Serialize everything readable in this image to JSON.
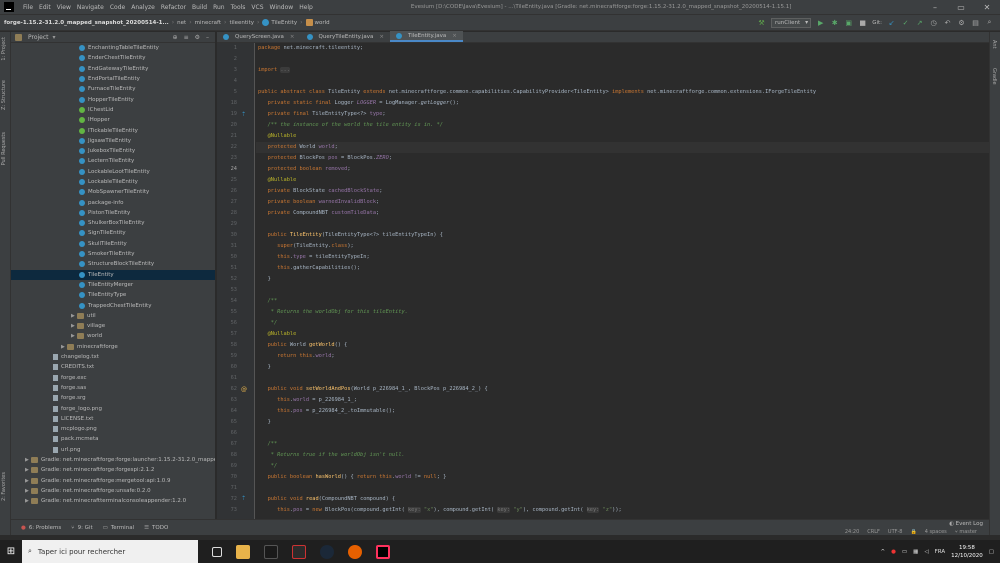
{
  "menubar": {
    "items": [
      "File",
      "Edit",
      "View",
      "Navigate",
      "Code",
      "Analyze",
      "Refactor",
      "Build",
      "Run",
      "Tools",
      "VCS",
      "Window",
      "Help"
    ],
    "title": "Evesium [D:\\CODE\\Java\\Evesium] - ...\\TileEntity.java [Gradle: net.minecraftforge:forge:1.15.2-31.2.0_mapped_snapshot_20200514-1.15.1]"
  },
  "navbar": {
    "project": "forge-1.15.2-31.2.0_mapped_snapshot_20200514-1...",
    "crumbs": [
      "net",
      "minecraft",
      "tileentity",
      "TileEntity",
      "world"
    ],
    "run_config": "runClient",
    "git_label": "Git:"
  },
  "left_strip": {
    "project": "1: Project",
    "structure": "Z: Structure",
    "pull_requests": "Pull Requests",
    "favorites": "2: Favorites"
  },
  "right_strip": {
    "ant": "Ant",
    "gradle": "Gradle"
  },
  "project_panel": {
    "title": "Project",
    "tree": [
      {
        "label": "EnchantingTableTileEntity",
        "kind": "cls",
        "indent": 68
      },
      {
        "label": "EnderChestTileEntity",
        "kind": "cls",
        "indent": 68
      },
      {
        "label": "EndGatewayTileEntity",
        "kind": "cls",
        "indent": 68
      },
      {
        "label": "EndPortalTileEntity",
        "kind": "cls",
        "indent": 68
      },
      {
        "label": "FurnaceTileEntity",
        "kind": "cls",
        "indent": 68
      },
      {
        "label": "HopperTileEntity",
        "kind": "cls",
        "indent": 68
      },
      {
        "label": "IChestLid",
        "kind": "i",
        "indent": 68
      },
      {
        "label": "IHopper",
        "kind": "i",
        "indent": 68
      },
      {
        "label": "ITickableTileEntity",
        "kind": "i",
        "indent": 68
      },
      {
        "label": "JigsawTileEntity",
        "kind": "cls",
        "indent": 68
      },
      {
        "label": "JukeboxTileEntity",
        "kind": "cls",
        "indent": 68
      },
      {
        "label": "LecternTileEntity",
        "kind": "cls",
        "indent": 68
      },
      {
        "label": "LockableLootTileEntity",
        "kind": "cls",
        "indent": 68
      },
      {
        "label": "LockableTileEntity",
        "kind": "cls",
        "indent": 68
      },
      {
        "label": "MobSpawnerTileEntity",
        "kind": "cls",
        "indent": 68
      },
      {
        "label": "package-info",
        "kind": "cls",
        "indent": 68
      },
      {
        "label": "PistonTileEntity",
        "kind": "cls",
        "indent": 68
      },
      {
        "label": "ShulkerBoxTileEntity",
        "kind": "cls",
        "indent": 68
      },
      {
        "label": "SignTileEntity",
        "kind": "cls",
        "indent": 68
      },
      {
        "label": "SkullTileEntity",
        "kind": "cls",
        "indent": 68
      },
      {
        "label": "SmokerTileEntity",
        "kind": "cls",
        "indent": 68
      },
      {
        "label": "StructureBlockTileEntity",
        "kind": "cls",
        "indent": 68
      },
      {
        "label": "TileEntity",
        "kind": "cls",
        "indent": 68,
        "selected": true
      },
      {
        "label": "TileEntityMerger",
        "kind": "cls",
        "indent": 68
      },
      {
        "label": "TileEntityType",
        "kind": "cls",
        "indent": 68
      },
      {
        "label": "TrappedChestTileEntity",
        "kind": "cls",
        "indent": 68
      },
      {
        "label": "util",
        "kind": "fold",
        "indent": 60,
        "arrow": "▶"
      },
      {
        "label": "village",
        "kind": "fold",
        "indent": 60,
        "arrow": "▶"
      },
      {
        "label": "world",
        "kind": "fold",
        "indent": 60,
        "arrow": "▶"
      },
      {
        "label": "minecraftforge",
        "kind": "fold",
        "indent": 50,
        "arrow": "▶"
      },
      {
        "label": "changelog.txt",
        "kind": "file",
        "indent": 42
      },
      {
        "label": "CREDITS.txt",
        "kind": "file",
        "indent": 42
      },
      {
        "label": "forge.exc",
        "kind": "file",
        "indent": 42
      },
      {
        "label": "forge.sas",
        "kind": "file",
        "indent": 42
      },
      {
        "label": "forge.srg",
        "kind": "file",
        "indent": 42
      },
      {
        "label": "forge_logo.png",
        "kind": "file",
        "indent": 42
      },
      {
        "label": "LICENSE.txt",
        "kind": "file",
        "indent": 42
      },
      {
        "label": "mcplogo.png",
        "kind": "file",
        "indent": 42
      },
      {
        "label": "pack.mcmeta",
        "kind": "file",
        "indent": 42
      },
      {
        "label": "url.png",
        "kind": "file",
        "indent": 42
      },
      {
        "label": "Gradle: net.minecraftforge:forge:launcher:1.15.2-31.2.0_mapped_sna",
        "kind": "fold",
        "indent": 14,
        "arrow": "▶"
      },
      {
        "label": "Gradle: net.minecraftforge:forgespi:2.1.2",
        "kind": "fold",
        "indent": 14,
        "arrow": "▶"
      },
      {
        "label": "Gradle: net.minecraftforge:mergetool:api:1.0.9",
        "kind": "fold",
        "indent": 14,
        "arrow": "▶"
      },
      {
        "label": "Gradle: net.minecraftforge:unsafe:0.2.0",
        "kind": "fold",
        "indent": 14,
        "arrow": "▶"
      },
      {
        "label": "Gradle: net.minecraftterminalconsoleappender:1.2.0",
        "kind": "fold",
        "indent": 14,
        "arrow": "▶"
      }
    ]
  },
  "tabs": [
    {
      "label": "QueryScreen.java",
      "active": false
    },
    {
      "label": "QueryTileEntity.java",
      "active": false
    },
    {
      "label": "TileEntity.java",
      "active": true
    }
  ],
  "bottom_tabs": [
    "6: Problems",
    "9: Git",
    "Terminal",
    "TODO"
  ],
  "event_log": "Event Log",
  "status": {
    "position": "24:20",
    "line_ending": "CRLF",
    "encoding": "UTF-8",
    "indent": "4 spaces",
    "branch": "master"
  },
  "taskbar": {
    "search_placeholder": "Taper ici pour rechercher",
    "time": "19:58",
    "date": "12/10/2020"
  }
}
